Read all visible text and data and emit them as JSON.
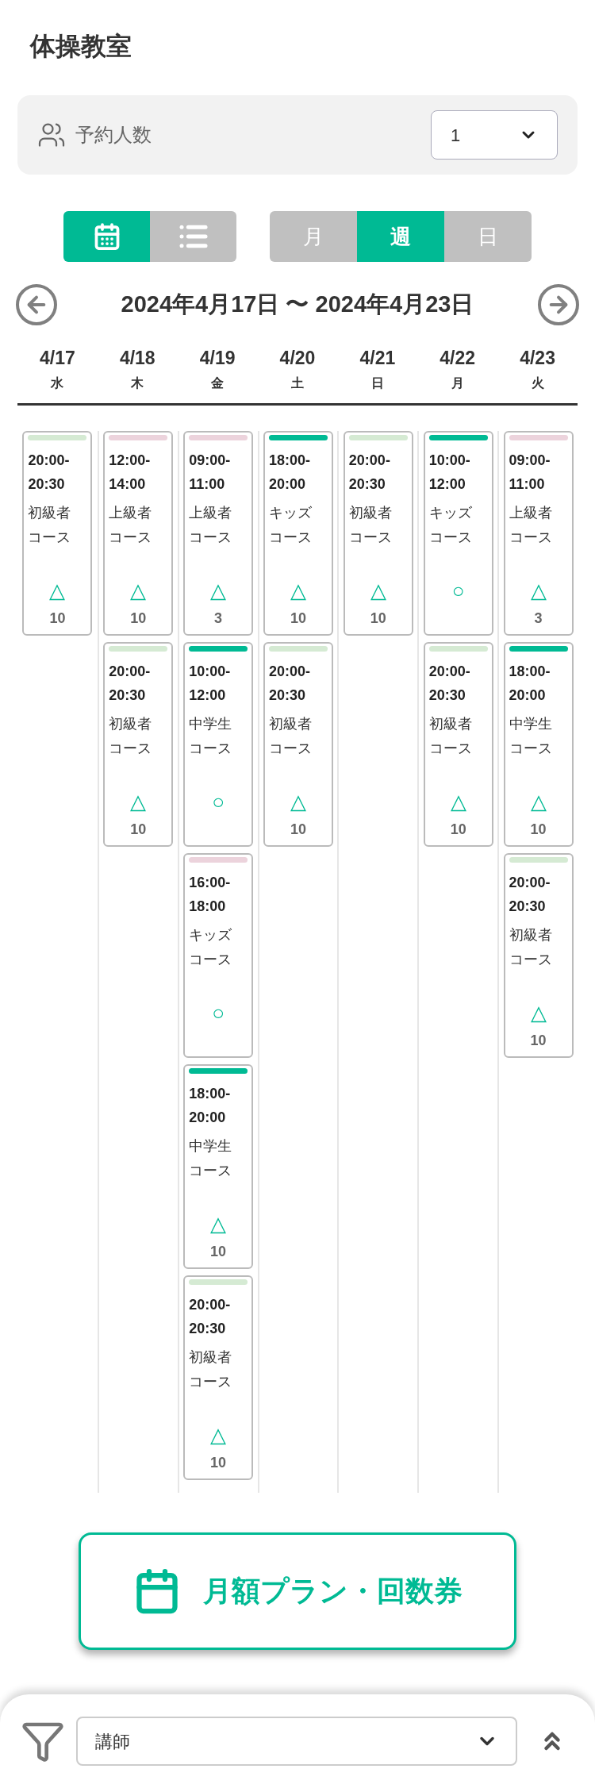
{
  "title": "体操教室",
  "party_size": {
    "label": "予約人数",
    "value": "1"
  },
  "view_toggle": [
    {
      "kind": "calendar",
      "selected": true
    },
    {
      "kind": "list",
      "selected": false
    }
  ],
  "period_tabs": [
    {
      "label": "月",
      "selected": false
    },
    {
      "label": "週",
      "selected": true
    },
    {
      "label": "日",
      "selected": false
    }
  ],
  "date_range": "2024年4月17日 〜 2024年4月23日",
  "days": [
    {
      "date": "4/17",
      "weekday": "水",
      "slots": [
        {
          "time": "20:00-20:30",
          "course": "初級者コース",
          "color": "#d5ead3",
          "availability": "△",
          "remaining": "10"
        }
      ]
    },
    {
      "date": "4/18",
      "weekday": "木",
      "slots": [
        {
          "time": "12:00-14:00",
          "course": "上級者コース",
          "color": "#ecd3dc",
          "availability": "△",
          "remaining": "10"
        },
        {
          "time": "20:00-20:30",
          "course": "初級者コース",
          "color": "#d5ead3",
          "availability": "△",
          "remaining": "10"
        }
      ]
    },
    {
      "date": "4/19",
      "weekday": "金",
      "slots": [
        {
          "time": "09:00-11:00",
          "course": "上級者コース",
          "color": "#ecd3dc",
          "availability": "△",
          "remaining": "3"
        },
        {
          "time": "10:00-12:00",
          "course": "中学生コース",
          "color": "#00ba94",
          "availability": "○"
        },
        {
          "time": "16:00-18:00",
          "course": "キッズコース",
          "color": "#ecd3dc",
          "availability": "○"
        },
        {
          "time": "18:00-20:00",
          "course": "中学生コース",
          "color": "#00ba94",
          "availability": "△",
          "remaining": "10"
        },
        {
          "time": "20:00-20:30",
          "course": "初級者コース",
          "color": "#d5ead3",
          "availability": "△",
          "remaining": "10"
        }
      ]
    },
    {
      "date": "4/20",
      "weekday": "土",
      "slots": [
        {
          "time": "18:00-20:00",
          "course": "キッズコース",
          "color": "#00ba94",
          "availability": "△",
          "remaining": "10"
        },
        {
          "time": "20:00-20:30",
          "course": "初級者コース",
          "color": "#d5ead3",
          "availability": "△",
          "remaining": "10"
        }
      ]
    },
    {
      "date": "4/21",
      "weekday": "日",
      "slots": [
        {
          "time": "20:00-20:30",
          "course": "初級者コース",
          "color": "#d5ead3",
          "availability": "△",
          "remaining": "10"
        }
      ]
    },
    {
      "date": "4/22",
      "weekday": "月",
      "slots": [
        {
          "time": "10:00-12:00",
          "course": "キッズコース",
          "color": "#00ba94",
          "availability": "○"
        },
        {
          "time": "20:00-20:30",
          "course": "初級者コース",
          "color": "#d5ead3",
          "availability": "△",
          "remaining": "10"
        }
      ]
    },
    {
      "date": "4/23",
      "weekday": "火",
      "slots": [
        {
          "time": "09:00-11:00",
          "course": "上級者コース",
          "color": "#ecd3dc",
          "availability": "△",
          "remaining": "3"
        },
        {
          "time": "18:00-20:00",
          "course": "中学生コース",
          "color": "#00ba94",
          "availability": "△",
          "remaining": "10"
        },
        {
          "time": "20:00-20:30",
          "course": "初級者コース",
          "color": "#d5ead3",
          "availability": "△",
          "remaining": "10"
        }
      ]
    }
  ],
  "plan_button": "月額プラン・回数券",
  "filter": {
    "value": "講師"
  }
}
